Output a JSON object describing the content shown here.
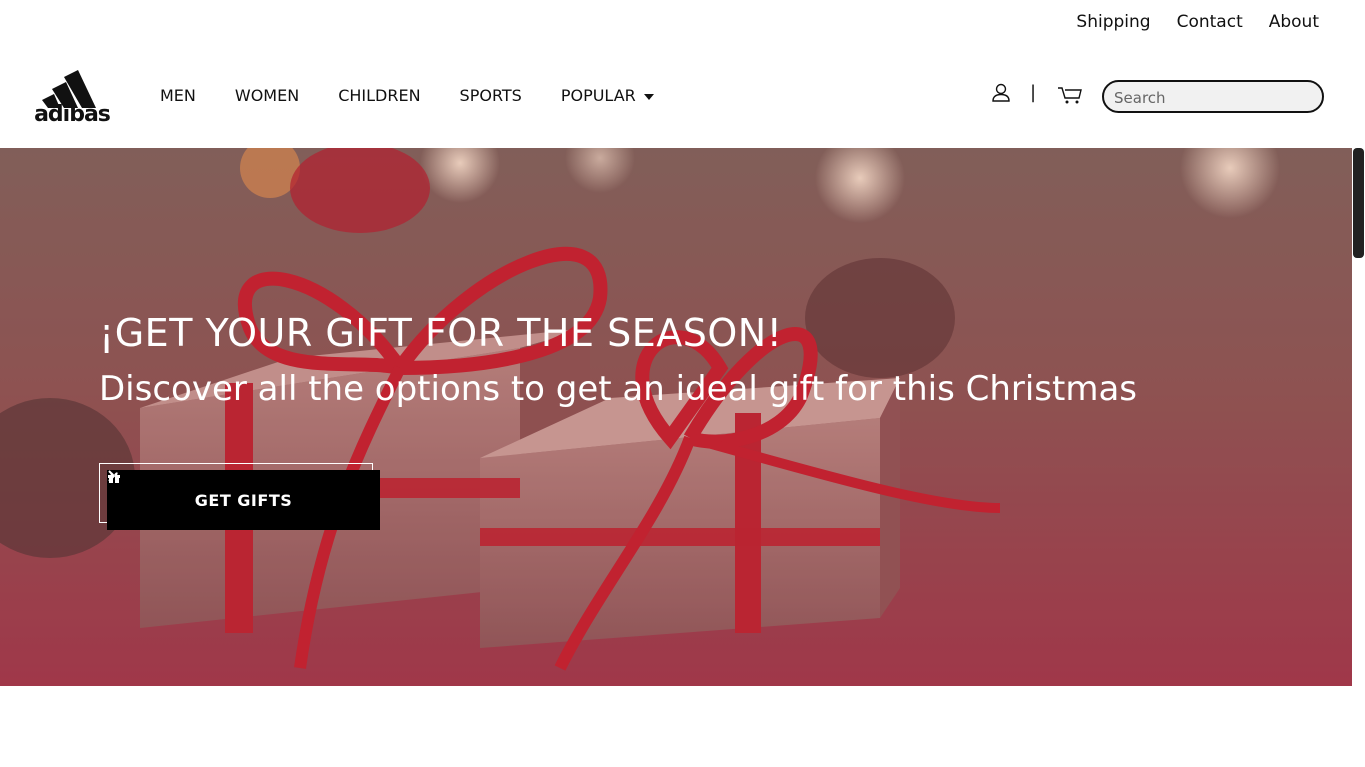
{
  "top_links": {
    "shipping": "Shipping",
    "contact": "Contact",
    "about": "About"
  },
  "brand": {
    "name": "adibas"
  },
  "nav": {
    "men": "MEN",
    "women": "WOMEN",
    "children": "CHILDREN",
    "sports": "SPORTS",
    "popular": "POPULAR"
  },
  "header_icons": {
    "user": "user-icon",
    "divider": "|",
    "cart": "cart-icon"
  },
  "search": {
    "placeholder": "Search"
  },
  "hero": {
    "title": "¡GET YOUR GIFT FOR THE SEASON!",
    "subtitle": "Discover all the options to get an ideal gift for this Christmas",
    "button_label": "GET GIFTS",
    "button_icons": [
      "gift-icon",
      "chevron-right-icon"
    ]
  },
  "colors": {
    "accent": "#000000",
    "hero_tint": "#a03a4b",
    "ribbon": "#c0242f"
  }
}
